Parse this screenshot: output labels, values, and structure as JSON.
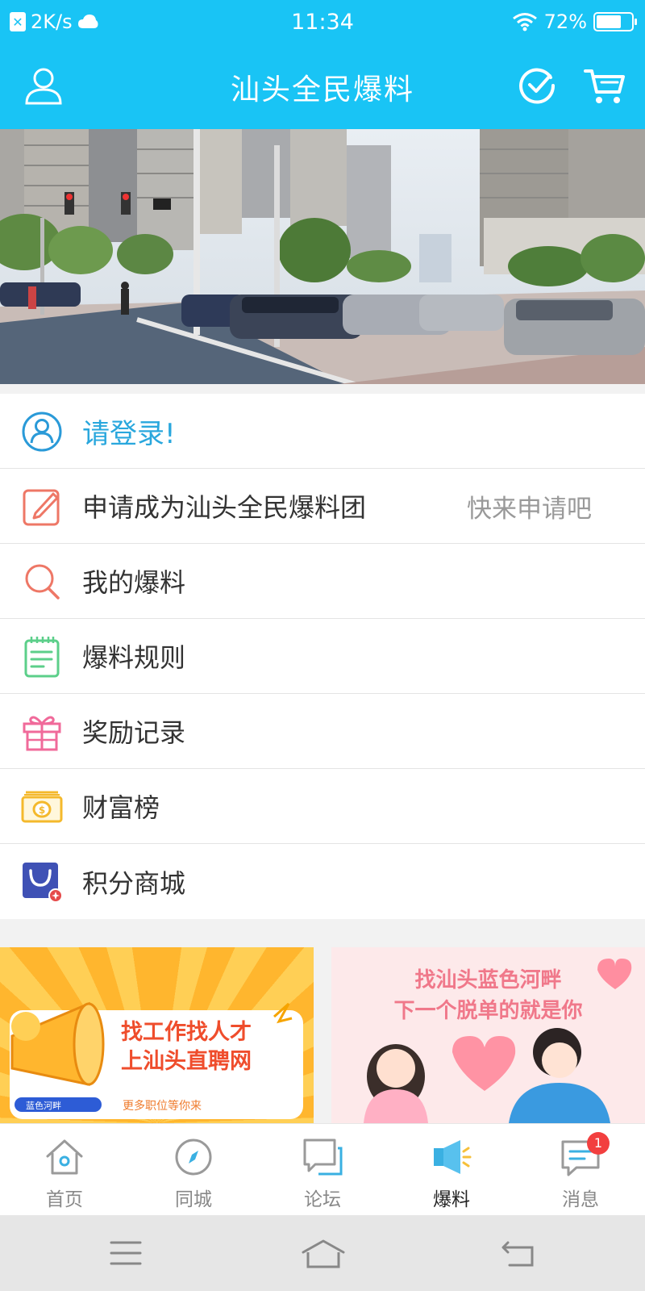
{
  "status_bar": {
    "net_speed": "2K/s",
    "time": "11:34",
    "battery": "72%",
    "battery_level": 0.72
  },
  "header": {
    "title": "汕头全民爆料",
    "icons": [
      "user-icon",
      "check-circle-icon",
      "cart-icon"
    ]
  },
  "menu": {
    "login": "请登录!",
    "items": [
      {
        "label": "申请成为汕头全民爆料团",
        "hint": "快来申请吧",
        "icon": "edit-icon",
        "color": "#ee7766"
      },
      {
        "label": "我的爆料",
        "icon": "search-icon",
        "color": "#ee7766"
      },
      {
        "label": "爆料规则",
        "icon": "notepad-icon",
        "color": "#5ccf8a"
      },
      {
        "label": "奖励记录",
        "icon": "gift-icon",
        "color": "#f06a9a"
      },
      {
        "label": "财富榜",
        "icon": "money-icon",
        "color": "#f4b92c"
      },
      {
        "label": "积分商城",
        "icon": "shopping-bag-icon",
        "color": "#3f51b5"
      }
    ]
  },
  "ads": {
    "left": {
      "line1": "找工作找人才",
      "line2": "上汕头直聘网",
      "tag": "蓝色河畔",
      "sub": "更多职位等你来"
    },
    "right": {
      "line1": "找汕头蓝色河畔",
      "line2": "下一个脱单的就是你"
    }
  },
  "tabs": [
    {
      "label": "首页",
      "icon": "home-icon"
    },
    {
      "label": "同城",
      "icon": "compass-icon"
    },
    {
      "label": "论坛",
      "icon": "forum-icon"
    },
    {
      "label": "爆料",
      "icon": "megaphone-icon",
      "active": true
    },
    {
      "label": "消息",
      "icon": "message-icon",
      "badge": "1"
    }
  ],
  "colors": {
    "brand": "#19c4f5",
    "login_text": "#29a7dd",
    "badge": "#f23f3f"
  }
}
